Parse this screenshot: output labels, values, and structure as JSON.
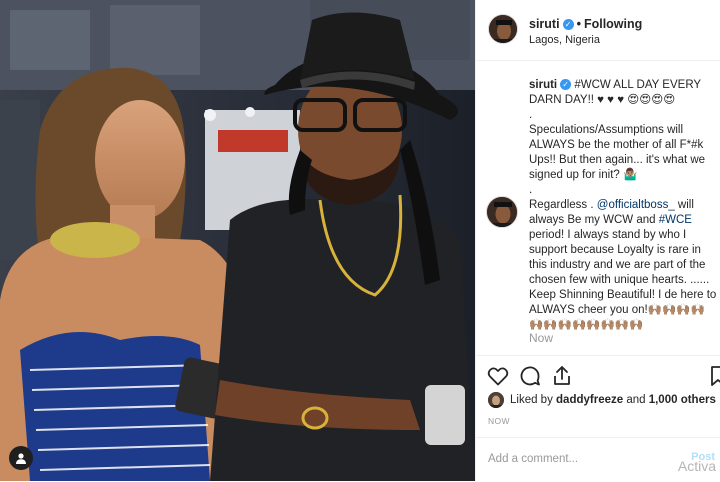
{
  "post": {
    "username": "siruti",
    "follow_status": "Following",
    "location": "Lagos, Nigeria",
    "caption_line1": "#WCW ALL DAY EVERY DARN DAY!! ♥ ♥ ♥ 😍😍😍😍",
    "caption_dot1": ".",
    "caption_line2": "Speculations/Assumptions will ALWAYS be the mother of all F*#k Ups!! But then again... it's what we signed up for init? 🤷🏽‍♂️",
    "caption_dot2": ".",
    "caption_line3_pre": "Regardless . ",
    "caption_mention": "@officialtboss_",
    "caption_line3_mid": " will always Be my WCW and ",
    "caption_tag": "#WCE",
    "caption_line3_post": " period! I always stand by who I support because Loyalty is rare in this industry and we are part of the chosen few with unique hearts. ...... Keep Shinning Beautiful! I de here to ALWAYS cheer you on!🙌🏽🙌🏽🙌🏽🙌🏽🙌🏽🙌🏽🙌🏽🙌🏽🙌🏽🙌🏽🙌🏽🙌🏽",
    "relative_time": "Now",
    "liked_by_prefix": "Liked by ",
    "liked_by_user": "daddyfreeze",
    "liked_by_join": " and ",
    "likes_count": "1,000 others",
    "timestamp": "NOW",
    "comment_placeholder": "Add a comment...",
    "post_button": "Post"
  },
  "overlay": {
    "watermark": "Activa"
  },
  "icons": [
    "heart-icon",
    "comment-icon",
    "share-icon",
    "bookmark-icon",
    "user-icon",
    "verified-badge-icon"
  ],
  "colors": {
    "accent_blue": "#3897f0",
    "link_blue": "#003569",
    "muted_gray": "#999999",
    "border": "#efefef"
  }
}
